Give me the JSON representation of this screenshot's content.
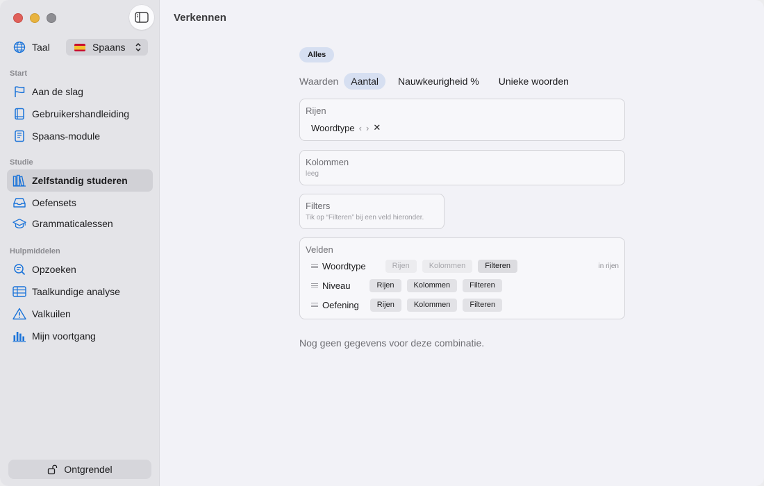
{
  "window": {
    "title": "Verkennen"
  },
  "sidebar": {
    "language_label": "Taal",
    "language_value": "Spaans",
    "sections": [
      {
        "title": "Start",
        "items": [
          {
            "label": "Aan de slag",
            "icon": "flag-icon"
          },
          {
            "label": "Gebruikershandleiding",
            "icon": "book-icon"
          },
          {
            "label": "Spaans-module",
            "icon": "module-book-icon"
          }
        ]
      },
      {
        "title": "Studie",
        "items": [
          {
            "label": "Zelfstandig studeren",
            "icon": "books-icon",
            "active": true
          },
          {
            "label": "Oefensets",
            "icon": "tray-icon"
          },
          {
            "label": "Grammaticalessen",
            "icon": "graduation-cap-icon"
          }
        ]
      },
      {
        "title": "Hulpmiddelen",
        "items": [
          {
            "label": "Opzoeken",
            "icon": "lookup-icon"
          },
          {
            "label": "Taalkundige analyse",
            "icon": "table-icon"
          },
          {
            "label": "Valkuilen",
            "icon": "warning-icon"
          },
          {
            "label": "Mijn voortgang",
            "icon": "bar-chart-icon"
          }
        ]
      }
    ],
    "unlock_label": "Ontgrendel"
  },
  "main": {
    "filter_all": "Alles",
    "values": {
      "label": "Waarden",
      "options": [
        "Aantal",
        "Nauwkeurigheid %",
        "Unieke woorden"
      ],
      "selected": "Aantal"
    },
    "rows": {
      "title": "Rijen",
      "chip": "Woordtype",
      "prev": "‹",
      "next": "›",
      "remove": "✕"
    },
    "columns": {
      "title": "Kolommen",
      "empty": "leeg"
    },
    "filters": {
      "title": "Filters",
      "hint": "Tik op “Filteren” bij een veld hieronder."
    },
    "fields": {
      "title": "Velden",
      "btn_rows": "Rijen",
      "btn_columns": "Kolommen",
      "btn_filter": "Filteren",
      "items": [
        {
          "name": "Woordtype",
          "note": "in rijen"
        },
        {
          "name": "Niveau"
        },
        {
          "name": "Oefening"
        }
      ]
    },
    "empty_message": "Nog geen gegevens voor deze combinatie."
  },
  "colors": {
    "accent": "#1a73d9",
    "selection": "#d6dff1"
  }
}
